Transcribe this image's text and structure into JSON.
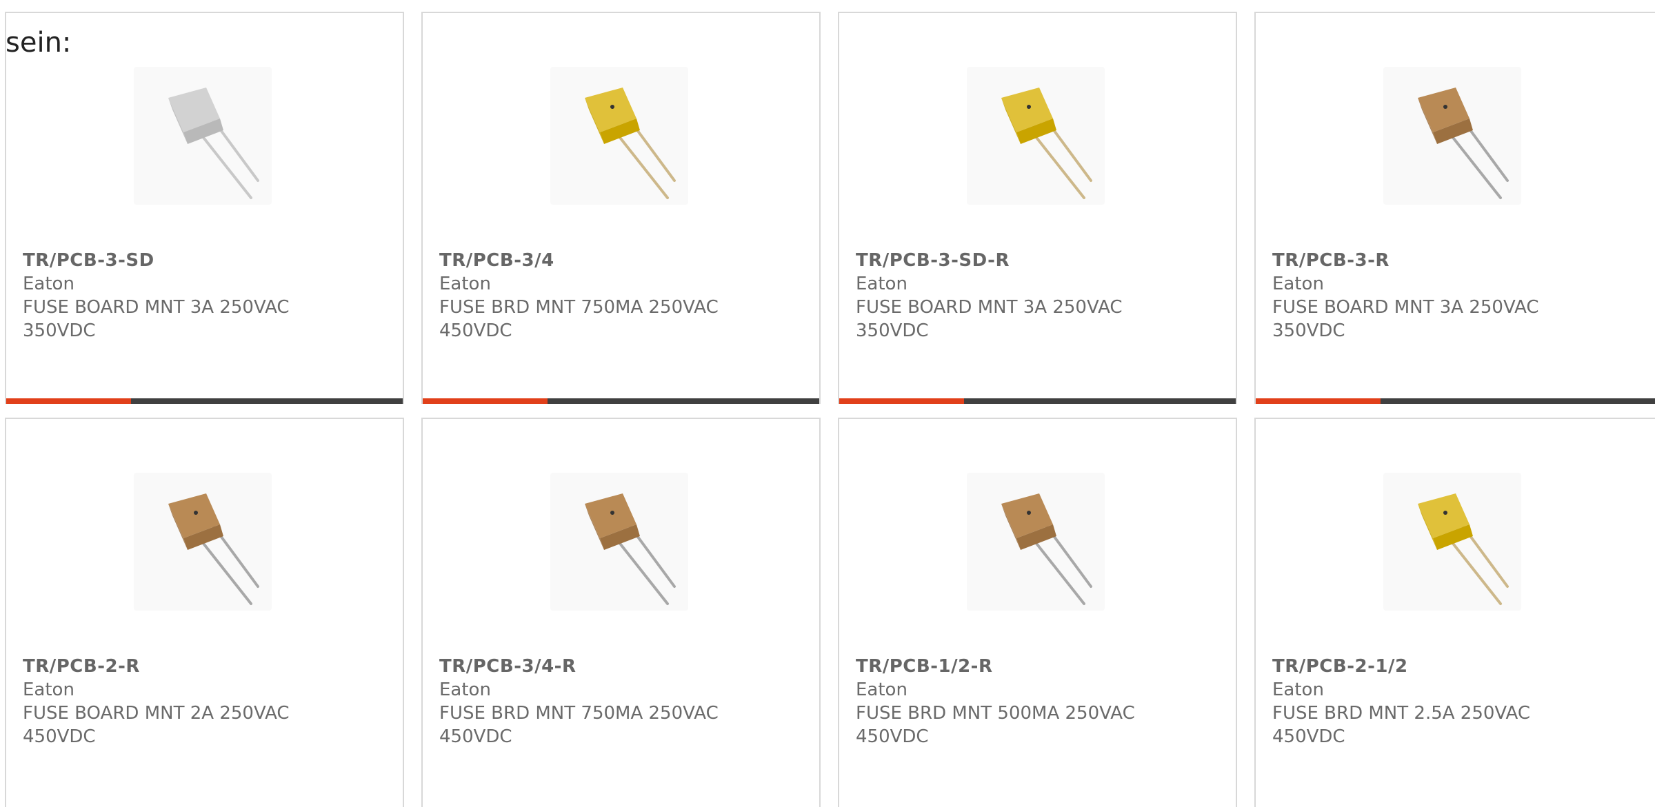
{
  "intro_text": "sein:",
  "products": [
    {
      "part": "TR/PCB-3-SD",
      "maker": "Eaton",
      "desc_line1": "FUSE BOARD MNT 3A 250VAC",
      "desc_line2": "350VDC",
      "body_color": "#b9b9b9",
      "top_color": "#d2d2d2",
      "lead_color": "#c8c8c8",
      "icon": "fuse-gray-image"
    },
    {
      "part": "TR/PCB-3/4",
      "maker": "Eaton",
      "desc_line1": "FUSE BRD MNT 750MA 250VAC",
      "desc_line2": "450VDC",
      "body_color": "#c9a400",
      "top_color": "#e0c13a",
      "lead_color": "#cdb88a",
      "icon": "fuse-yellow-image"
    },
    {
      "part": "TR/PCB-3-SD-R",
      "maker": "Eaton",
      "desc_line1": "FUSE BOARD MNT 3A 250VAC",
      "desc_line2": "350VDC",
      "body_color": "#c9a400",
      "top_color": "#e0c13a",
      "lead_color": "#cdb88a",
      "icon": "fuse-yellow-image"
    },
    {
      "part": "TR/PCB-3-R",
      "maker": "Eaton",
      "desc_line1": "FUSE BOARD MNT 3A 250VAC",
      "desc_line2": "350VDC",
      "body_color": "#9c7040",
      "top_color": "#b98a55",
      "lead_color": "#a8a8a8",
      "icon": "fuse-brown-image"
    },
    {
      "part": "TR/PCB-2-R",
      "maker": "Eaton",
      "desc_line1": "FUSE BOARD MNT 2A 250VAC",
      "desc_line2": "450VDC",
      "body_color": "#9c7040",
      "top_color": "#b98a55",
      "lead_color": "#a8a8a8",
      "icon": "fuse-brown-image"
    },
    {
      "part": "TR/PCB-3/4-R",
      "maker": "Eaton",
      "desc_line1": "FUSE BRD MNT 750MA 250VAC",
      "desc_line2": "450VDC",
      "body_color": "#9c7040",
      "top_color": "#b98a55",
      "lead_color": "#a8a8a8",
      "icon": "fuse-brown-image"
    },
    {
      "part": "TR/PCB-1/2-R",
      "maker": "Eaton",
      "desc_line1": "FUSE BRD MNT 500MA 250VAC",
      "desc_line2": "450VDC",
      "body_color": "#9c7040",
      "top_color": "#b98a55",
      "lead_color": "#a8a8a8",
      "icon": "fuse-brown-image"
    },
    {
      "part": "TR/PCB-2-1/2",
      "maker": "Eaton",
      "desc_line1": "FUSE BRD MNT 2.5A 250VAC",
      "desc_line2": "450VDC",
      "body_color": "#c9a400",
      "top_color": "#e0c13a",
      "lead_color": "#cdb88a",
      "icon": "fuse-yellow-image"
    }
  ],
  "accent_color": "#e1401a",
  "bar_color": "#404040"
}
